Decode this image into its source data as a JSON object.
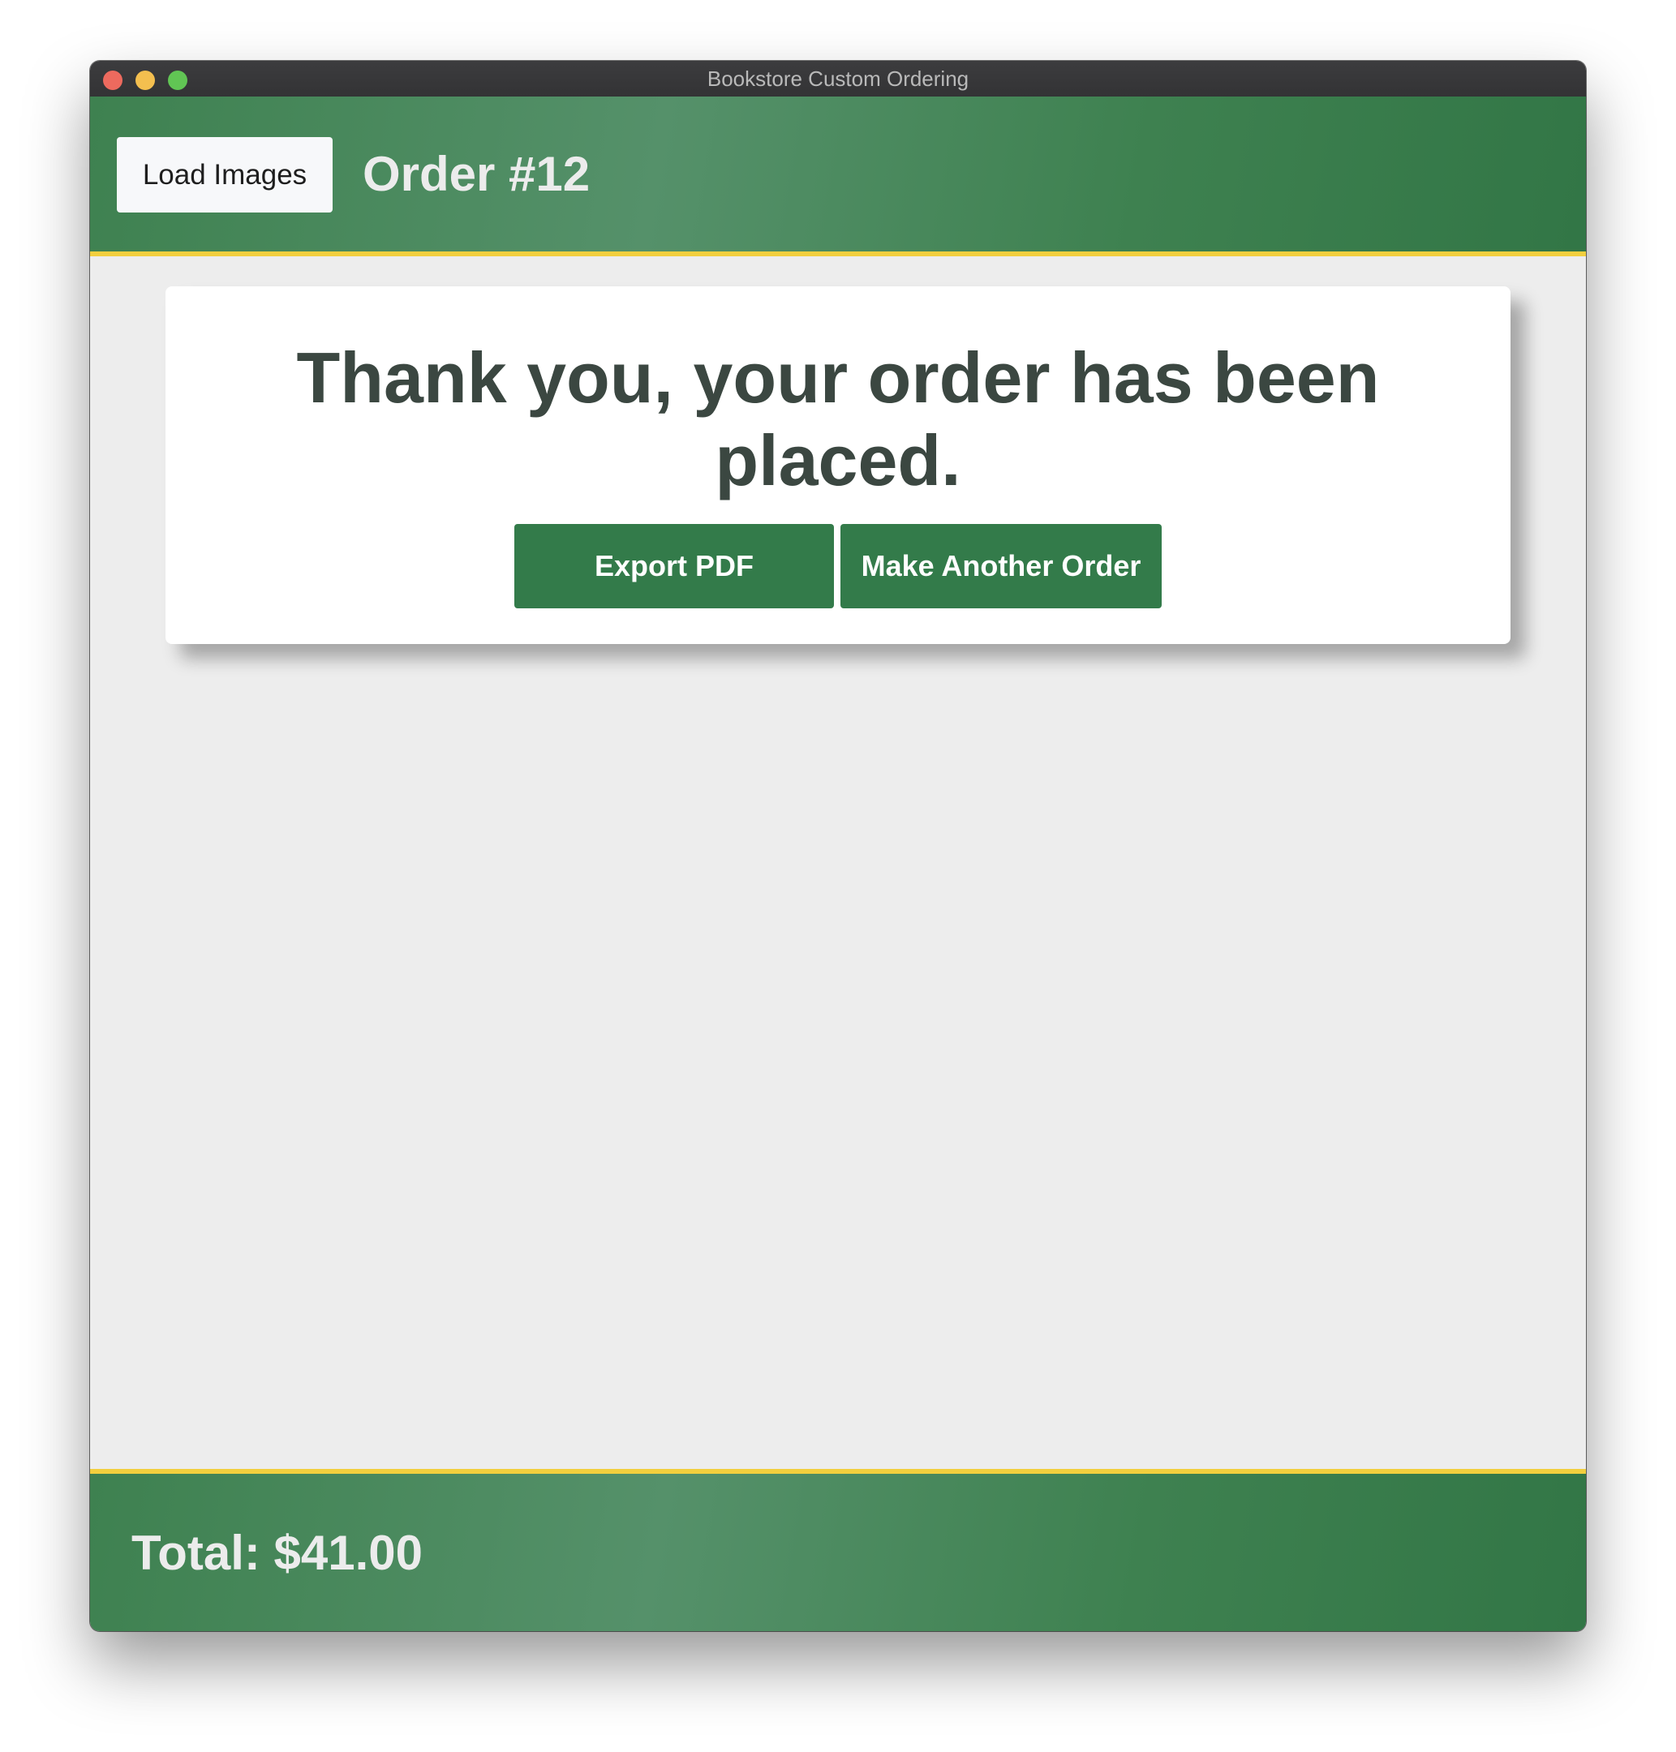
{
  "window": {
    "title": "Bookstore Custom Ordering"
  },
  "header": {
    "load_images_label": "Load Images",
    "order_title": "Order #12"
  },
  "confirmation": {
    "message": "Thank you, your order has been placed.",
    "export_pdf_label": "Export PDF",
    "make_another_order_label": "Make Another Order"
  },
  "footer": {
    "total": "Total: $41.00"
  },
  "colors": {
    "brand_green": "#337b4a",
    "accent_yellow": "#f2cf3e",
    "background": "#ededed",
    "heading_text": "#3b4741"
  },
  "icons": [
    "close-window-icon",
    "minimize-window-icon",
    "maximize-window-icon"
  ]
}
